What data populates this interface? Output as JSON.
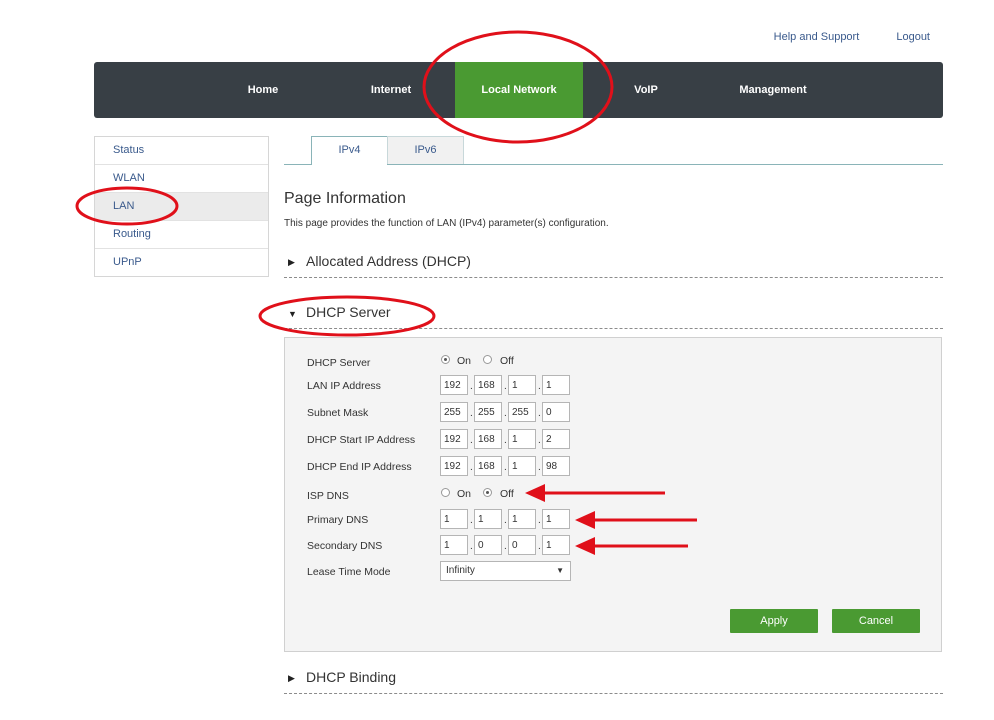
{
  "top_links": {
    "help": "Help and Support",
    "logout": "Logout"
  },
  "nav": {
    "items": [
      {
        "label": "Home",
        "active": false
      },
      {
        "label": "Internet",
        "active": false
      },
      {
        "label": "Local Network",
        "active": true
      },
      {
        "label": "VoIP",
        "active": false
      },
      {
        "label": "Management",
        "active": false
      }
    ]
  },
  "sidebar": {
    "items": [
      {
        "label": "Status"
      },
      {
        "label": "WLAN"
      },
      {
        "label": "LAN",
        "active": true
      },
      {
        "label": "Routing"
      },
      {
        "label": "UPnP"
      }
    ]
  },
  "tabs": [
    {
      "label": "IPv4",
      "active": true
    },
    {
      "label": "IPv6"
    }
  ],
  "page": {
    "title": "Page Information",
    "description": "This page provides the function of LAN (IPv4) parameter(s) configuration."
  },
  "sections": {
    "allocated": "Allocated Address (DHCP)",
    "dhcp_server": "DHCP Server",
    "dhcp_binding": "DHCP Binding"
  },
  "form": {
    "dhcp_server": {
      "label": "DHCP Server",
      "on": "On",
      "off": "Off",
      "selected": "On"
    },
    "lan_ip": {
      "label": "LAN IP Address",
      "octets": [
        "192",
        "168",
        "1",
        "1"
      ]
    },
    "subnet_mask": {
      "label": "Subnet Mask",
      "octets": [
        "255",
        "255",
        "255",
        "0"
      ]
    },
    "start_ip": {
      "label": "DHCP Start IP Address",
      "octets": [
        "192",
        "168",
        "1",
        "2"
      ]
    },
    "end_ip": {
      "label": "DHCP End IP Address",
      "octets": [
        "192",
        "168",
        "1",
        "98"
      ]
    },
    "isp_dns": {
      "label": "ISP DNS",
      "on": "On",
      "off": "Off",
      "selected": "Off"
    },
    "primary_dns": {
      "label": "Primary DNS",
      "octets": [
        "1",
        "1",
        "1",
        "1"
      ]
    },
    "secondary_dns": {
      "label": "Secondary DNS",
      "octets": [
        "1",
        "0",
        "0",
        "1"
      ]
    },
    "lease_time": {
      "label": "Lease Time Mode",
      "value": "Infinity"
    },
    "apply": "Apply",
    "cancel": "Cancel"
  },
  "icons": {
    "collapsed": "triangle-right-icon",
    "expanded": "triangle-down-icon",
    "dropdown": "caret-down-icon"
  },
  "colors": {
    "navbar": "#383f45",
    "active_nav": "#4a9a32",
    "button": "#4a9a32",
    "annotation": "#e0101a"
  }
}
